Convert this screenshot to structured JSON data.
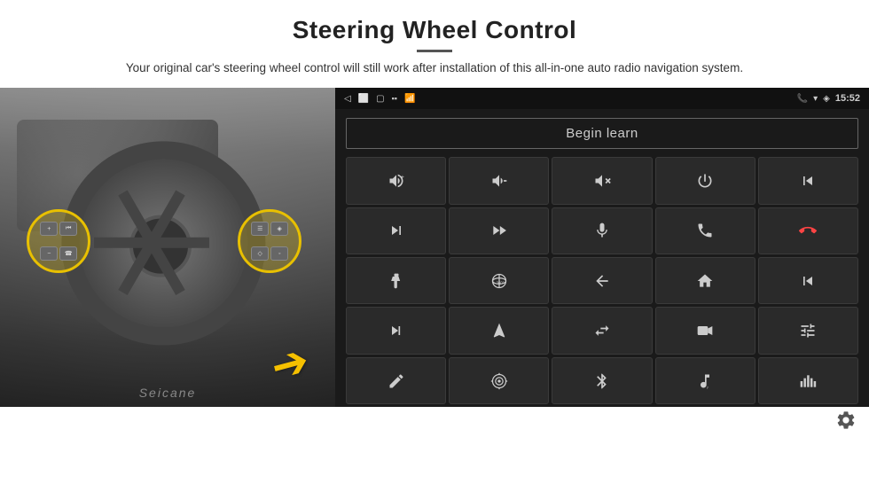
{
  "page": {
    "title": "Steering Wheel Control",
    "divider": true,
    "subtitle": "Your original car's steering wheel control will still work after installation of this all-in-one auto radio navigation system."
  },
  "statusBar": {
    "time": "15:52",
    "icons": [
      "back-icon",
      "home-icon",
      "recent-icon",
      "sim-icon",
      "signal-icon",
      "phone-icon",
      "wifi-icon",
      "gps-icon"
    ]
  },
  "beginLearn": {
    "label": "Begin learn"
  },
  "controls": {
    "rows": [
      [
        "vol+",
        "vol-",
        "mute",
        "power",
        "prev-track"
      ],
      [
        "next",
        "fast-forward",
        "mic",
        "phone",
        "hang-up"
      ],
      [
        "flashlight",
        "360",
        "back",
        "home",
        "skip-back"
      ],
      [
        "skip-forward",
        "navigate",
        "swap",
        "record",
        "equalizer"
      ],
      [
        "pen",
        "target",
        "bluetooth",
        "music",
        "bars"
      ]
    ]
  },
  "bottomBar": {
    "gear_label": "settings"
  },
  "seicane": {
    "text": "Seicane"
  }
}
